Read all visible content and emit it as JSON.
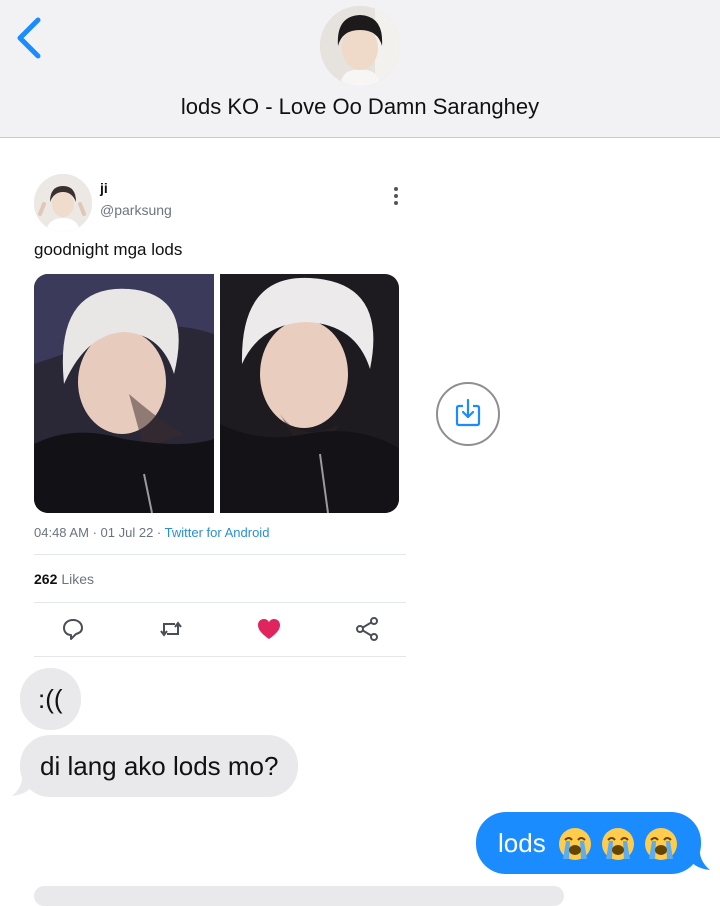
{
  "header": {
    "title": "lods KO - Love Oo Damn Saranghey",
    "back_icon": "chevron-left-icon",
    "accent_color": "#1a8cfe"
  },
  "tweet": {
    "name": "ji",
    "handle": "@parksung",
    "text": "goodnight mga lods",
    "time": "04:48 AM",
    "date": "01 Jul 22",
    "source": "Twitter for Android",
    "likes_count": "262",
    "likes_label": "Likes",
    "separator": "·",
    "actions": [
      "reply-icon",
      "retweet-icon",
      "like-icon",
      "share-icon"
    ],
    "like_color": "#e0245e",
    "source_color": "#2a8fd6"
  },
  "messages": [
    {
      "from": "them",
      "text": ":(("
    },
    {
      "from": "them",
      "text": "di lang ako lods mo?"
    },
    {
      "from": "me",
      "text": "lods",
      "emoji": [
        "loudly-crying-face",
        "loudly-crying-face",
        "loudly-crying-face"
      ]
    }
  ],
  "colors": {
    "incoming_bubble": "#e9e9eb",
    "outgoing_bubble": "#1a8cfe",
    "header_bg": "#f2f2f5"
  }
}
